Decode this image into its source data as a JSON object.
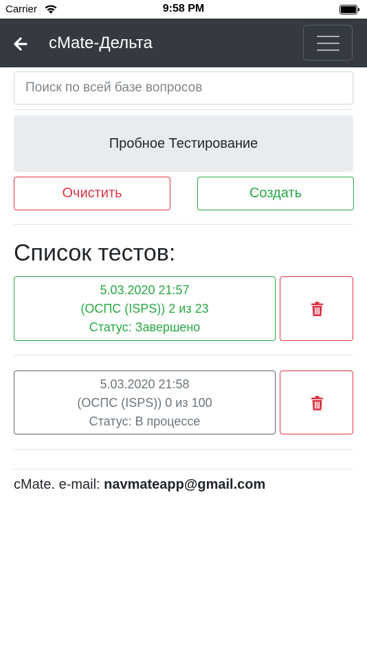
{
  "status_bar": {
    "carrier": "Carrier",
    "time": "9:58 PM",
    "wifi_icon": "wifi-icon",
    "battery_icon": "battery-icon"
  },
  "navbar": {
    "title": "cMate-Дельта",
    "back_icon": "arrow-left-icon",
    "menu_icon": "hamburger-menu-icon",
    "background": "#343a40"
  },
  "search": {
    "placeholder": "Поиск по всей базе вопросов",
    "value": ""
  },
  "trial_button": {
    "label": "Пробное Тестирование"
  },
  "actions": {
    "clear_label": "Очистить",
    "create_label": "Создать",
    "clear_color": "#dc3545",
    "create_color": "#28a745"
  },
  "list": {
    "title": "Список тестов:",
    "tests": [
      {
        "datetime": "5.03.2020 21:57",
        "name": "(ОСПС (ISPS)) 2 из 23",
        "status": "Статус: Завершено",
        "color": "#28a745",
        "delete_icon": "trash-icon"
      },
      {
        "datetime": "5.03.2020 21:58",
        "name": "(ОСПС (ISPS)) 0 из 100",
        "status": "Статус: В процессе",
        "color": "#6c757d",
        "delete_icon": "trash-icon"
      }
    ]
  },
  "footer": {
    "prefix": "cMate. e-mail: ",
    "email": "navmateapp@gmail.com"
  }
}
